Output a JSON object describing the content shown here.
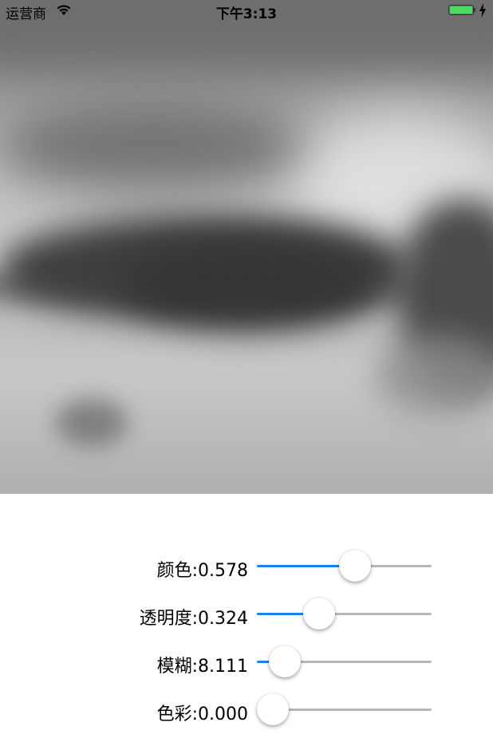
{
  "status_bar": {
    "carrier": "运营商",
    "time": "下午3:13",
    "icons": [
      "wifi-icon",
      "battery-icon",
      "charging-bolt-icon"
    ],
    "battery_color": "#4cd964"
  },
  "image": {
    "description_icon": "blurred-grayscale-photo"
  },
  "sliders": [
    {
      "label": "颜色:0.578",
      "value": 0.578,
      "min": 0,
      "max": 1
    },
    {
      "label": "透明度:0.324",
      "value": 0.324,
      "min": 0,
      "max": 1
    },
    {
      "label": "模糊:8.111",
      "value": 8.111,
      "min": 0,
      "max": 100
    },
    {
      "label": "色彩:0.000",
      "value": 0.0,
      "min": 0,
      "max": 1
    }
  ],
  "colors": {
    "slider_min_track": "#1a82f0",
    "slider_max_track": "#b7b7b7",
    "thumb": "#ffffff"
  }
}
